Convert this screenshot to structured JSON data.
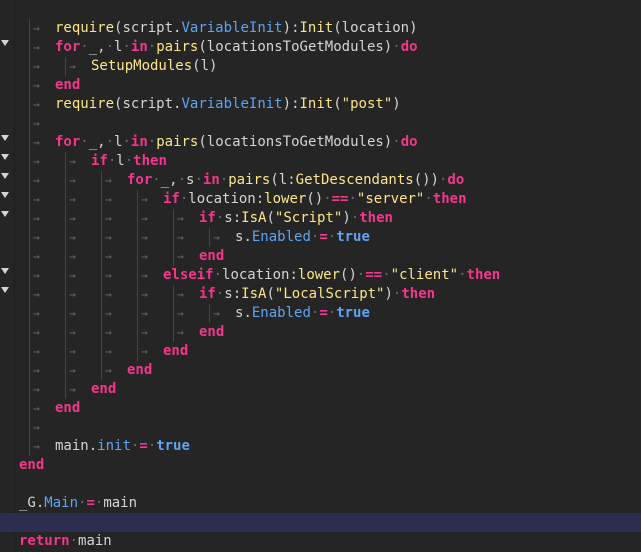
{
  "editor": {
    "lines": [
      {
        "indent": 1,
        "fold": false,
        "tokens": [
          [
            "fn",
            "require"
          ],
          [
            "op",
            "(script"
          ],
          [
            "op",
            "."
          ],
          [
            "prop",
            "VariableInit"
          ],
          [
            "op",
            ")"
          ],
          [
            "op",
            ":"
          ],
          [
            "fn",
            "Init"
          ],
          [
            "op",
            "(location)"
          ]
        ]
      },
      {
        "indent": 1,
        "fold": true,
        "tokens": [
          [
            "kw",
            "for"
          ],
          [
            "ws",
            "·"
          ],
          [
            "id",
            "_"
          ],
          [
            "op",
            ","
          ],
          [
            "ws",
            "·"
          ],
          [
            "id",
            "l"
          ],
          [
            "ws",
            "·"
          ],
          [
            "kw",
            "in"
          ],
          [
            "ws",
            "·"
          ],
          [
            "fn",
            "pairs"
          ],
          [
            "op",
            "(locationsToGetModules)"
          ],
          [
            "ws",
            "·"
          ],
          [
            "kw",
            "do"
          ]
        ]
      },
      {
        "indent": 2,
        "fold": false,
        "tokens": [
          [
            "fn",
            "SetupModules"
          ],
          [
            "op",
            "(l)"
          ]
        ]
      },
      {
        "indent": 1,
        "fold": false,
        "tokens": [
          [
            "kw",
            "end"
          ]
        ]
      },
      {
        "indent": 1,
        "fold": false,
        "tokens": [
          [
            "fn",
            "require"
          ],
          [
            "op",
            "(script"
          ],
          [
            "op",
            "."
          ],
          [
            "prop",
            "VariableInit"
          ],
          [
            "op",
            ")"
          ],
          [
            "op",
            ":"
          ],
          [
            "fn",
            "Init"
          ],
          [
            "op",
            "("
          ],
          [
            "str",
            "\"post\""
          ],
          [
            "op",
            ")"
          ]
        ]
      },
      {
        "indent": 1,
        "fold": false,
        "tokens": []
      },
      {
        "indent": 1,
        "fold": true,
        "tokens": [
          [
            "kw",
            "for"
          ],
          [
            "ws",
            "·"
          ],
          [
            "id",
            "_"
          ],
          [
            "op",
            ","
          ],
          [
            "ws",
            "·"
          ],
          [
            "id",
            "l"
          ],
          [
            "ws",
            "·"
          ],
          [
            "kw",
            "in"
          ],
          [
            "ws",
            "·"
          ],
          [
            "fn",
            "pairs"
          ],
          [
            "op",
            "(locationsToGetModules)"
          ],
          [
            "ws",
            "·"
          ],
          [
            "kw",
            "do"
          ]
        ]
      },
      {
        "indent": 2,
        "fold": true,
        "tokens": [
          [
            "kw",
            "if"
          ],
          [
            "ws",
            "·"
          ],
          [
            "id",
            "l"
          ],
          [
            "ws",
            "·"
          ],
          [
            "kw",
            "then"
          ]
        ]
      },
      {
        "indent": 3,
        "fold": true,
        "tokens": [
          [
            "kw",
            "for"
          ],
          [
            "ws",
            "·"
          ],
          [
            "id",
            "_"
          ],
          [
            "op",
            ","
          ],
          [
            "ws",
            "·"
          ],
          [
            "id",
            "s"
          ],
          [
            "ws",
            "·"
          ],
          [
            "kw",
            "in"
          ],
          [
            "ws",
            "·"
          ],
          [
            "fn",
            "pairs"
          ],
          [
            "op",
            "(l"
          ],
          [
            "op",
            ":"
          ],
          [
            "fn",
            "GetDescendants"
          ],
          [
            "op",
            "())"
          ],
          [
            "ws",
            "·"
          ],
          [
            "kw",
            "do"
          ]
        ]
      },
      {
        "indent": 4,
        "fold": true,
        "tokens": [
          [
            "kw",
            "if"
          ],
          [
            "ws",
            "·"
          ],
          [
            "id",
            "location"
          ],
          [
            "op",
            ":"
          ],
          [
            "fn",
            "lower"
          ],
          [
            "op",
            "()"
          ],
          [
            "ws",
            "·"
          ],
          [
            "kw",
            "=="
          ],
          [
            "ws",
            "·"
          ],
          [
            "str",
            "\"server\""
          ],
          [
            "ws",
            "·"
          ],
          [
            "kw",
            "then"
          ]
        ]
      },
      {
        "indent": 5,
        "fold": true,
        "tokens": [
          [
            "kw",
            "if"
          ],
          [
            "ws",
            "·"
          ],
          [
            "id",
            "s"
          ],
          [
            "op",
            ":"
          ],
          [
            "fn",
            "IsA"
          ],
          [
            "op",
            "("
          ],
          [
            "str",
            "\"Script\""
          ],
          [
            "op",
            ")"
          ],
          [
            "ws",
            "·"
          ],
          [
            "kw",
            "then"
          ]
        ]
      },
      {
        "indent": 6,
        "fold": false,
        "tokens": [
          [
            "id",
            "s"
          ],
          [
            "op",
            "."
          ],
          [
            "prop",
            "Enabled"
          ],
          [
            "ws",
            "·"
          ],
          [
            "kw",
            "="
          ],
          [
            "ws",
            "·"
          ],
          [
            "bool",
            "true"
          ]
        ]
      },
      {
        "indent": 5,
        "fold": false,
        "tokens": [
          [
            "kw",
            "end"
          ]
        ]
      },
      {
        "indent": 4,
        "fold": true,
        "tokens": [
          [
            "kw",
            "elseif"
          ],
          [
            "ws",
            "·"
          ],
          [
            "id",
            "location"
          ],
          [
            "op",
            ":"
          ],
          [
            "fn",
            "lower"
          ],
          [
            "op",
            "()"
          ],
          [
            "ws",
            "·"
          ],
          [
            "kw",
            "=="
          ],
          [
            "ws",
            "·"
          ],
          [
            "str",
            "\"client\""
          ],
          [
            "ws",
            "·"
          ],
          [
            "kw",
            "then"
          ]
        ]
      },
      {
        "indent": 5,
        "fold": true,
        "tokens": [
          [
            "kw",
            "if"
          ],
          [
            "ws",
            "·"
          ],
          [
            "id",
            "s"
          ],
          [
            "op",
            ":"
          ],
          [
            "fn",
            "IsA"
          ],
          [
            "op",
            "("
          ],
          [
            "str",
            "\"LocalScript\""
          ],
          [
            "op",
            ")"
          ],
          [
            "ws",
            "·"
          ],
          [
            "kw",
            "then"
          ]
        ]
      },
      {
        "indent": 6,
        "fold": false,
        "tokens": [
          [
            "id",
            "s"
          ],
          [
            "op",
            "."
          ],
          [
            "prop",
            "Enabled"
          ],
          [
            "ws",
            "·"
          ],
          [
            "kw",
            "="
          ],
          [
            "ws",
            "·"
          ],
          [
            "bool",
            "true"
          ]
        ]
      },
      {
        "indent": 5,
        "fold": false,
        "tokens": [
          [
            "kw",
            "end"
          ]
        ]
      },
      {
        "indent": 4,
        "fold": false,
        "tokens": [
          [
            "kw",
            "end"
          ]
        ]
      },
      {
        "indent": 3,
        "fold": false,
        "tokens": [
          [
            "kw",
            "end"
          ]
        ]
      },
      {
        "indent": 2,
        "fold": false,
        "tokens": [
          [
            "kw",
            "end"
          ]
        ]
      },
      {
        "indent": 1,
        "fold": false,
        "tokens": [
          [
            "kw",
            "end"
          ]
        ]
      },
      {
        "indent": 1,
        "fold": false,
        "tokens": []
      },
      {
        "indent": 1,
        "fold": false,
        "tokens": [
          [
            "id",
            "main"
          ],
          [
            "op",
            "."
          ],
          [
            "prop",
            "init"
          ],
          [
            "ws",
            "·"
          ],
          [
            "kw",
            "="
          ],
          [
            "ws",
            "·"
          ],
          [
            "bool",
            "true"
          ]
        ]
      },
      {
        "indent": 0,
        "fold": false,
        "tokens": [
          [
            "kw",
            "end"
          ]
        ]
      },
      {
        "indent": 0,
        "fold": false,
        "tokens": []
      },
      {
        "indent": 0,
        "fold": false,
        "tokens": [
          [
            "id",
            "_G"
          ],
          [
            "op",
            "."
          ],
          [
            "prop",
            "Main"
          ],
          [
            "ws",
            "·"
          ],
          [
            "kw",
            "="
          ],
          [
            "ws",
            "·"
          ],
          [
            "id",
            "main"
          ]
        ]
      },
      {
        "indent": 0,
        "fold": false,
        "current": true,
        "tokens": []
      },
      {
        "indent": 0,
        "fold": false,
        "tokens": [
          [
            "kw",
            "return"
          ],
          [
            "ws",
            "·"
          ],
          [
            "id",
            "main"
          ]
        ]
      }
    ]
  },
  "colors": {
    "background": "#252526",
    "keyword": "#f5368e",
    "function": "#fde58a",
    "property": "#5fa4f0",
    "current_line": "#2d2e4f"
  }
}
